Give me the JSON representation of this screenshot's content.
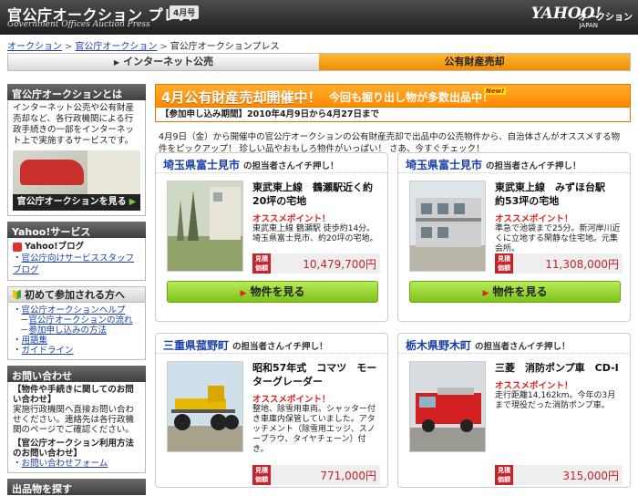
{
  "header": {
    "title": "官公庁オークション プレス",
    "issue_badge": "4月号",
    "subtitle": "Government Offices Auction Press",
    "logo": "YAHOO!",
    "logo_sub": "JAPAN",
    "auction_label": "オークション"
  },
  "breadcrumb": {
    "items": [
      "オークション",
      "官公庁オークション",
      "官公庁オークションプレス"
    ]
  },
  "tabs": [
    {
      "label": "インターネット公売",
      "active": false
    },
    {
      "label": "公有財産売却",
      "active": true
    }
  ],
  "sidebar": {
    "about": {
      "heading": "官公庁オークションとは",
      "text": "インターネット公売や公有財産売却など、各行政機関による行政手続きの一部をインターネット上で実施するサービスです。",
      "button_label": "官公庁オークションを見る"
    },
    "yahoo_services": {
      "heading": "Yahoo!サービス",
      "items": [
        "Yahoo!ブログ",
        "官公庁向けサービススタッフブログ"
      ]
    },
    "first_time": {
      "heading": "初めて参加される方へ",
      "items": [
        {
          "label": "官公庁オークションヘルプ",
          "indent": false
        },
        {
          "label": "官公庁オークションの流れ",
          "indent": true
        },
        {
          "label": "参加申し込みの方法",
          "indent": true
        },
        {
          "label": "用語集",
          "indent": false
        },
        {
          "label": "ガイドライン",
          "indent": false
        }
      ]
    },
    "contact": {
      "heading": "お問い合わせ",
      "q1_title": "【物件や手続きに関してのお問い合わせ】",
      "q1_text": "実施行政機関へ直接お問い合わせください。連絡先は各行政機関のページでご確認ください。",
      "q2_title": "【官公庁オークション利用方法のお問い合わせ】",
      "q2_link": "お問い合わせフォーム"
    },
    "search_heading": "出品物を探す"
  },
  "main": {
    "banner_title": "4月公有財産売却開催中！",
    "banner_sub": "今回も掘り出し物が多数出品中！",
    "banner_new": "New!",
    "period": "【参加申し込み期間】2010年4月9日から4月27日まで",
    "intro": "4月9日（金）から開催中の官公庁オークションの公有財産売却で出品中の公売物件から、自治体さんがオススメする物件をピックアップ！ 珍しい品やおもしろ物件がいっぱい！ さあ、今すぐチェック！",
    "point_label": "オススメポイント！",
    "price_label": "見積価額",
    "view_label": "物件を見る",
    "header_tail": "の担当者さんイチ押し！",
    "cards": [
      {
        "pref": "埼玉県富士見市",
        "title": "東武東上線　鶴瀬駅近く約20坪の宅地",
        "desc": "東武東上線 鶴瀬駅 徒歩約14分。埼玉県富士見市、約20坪の宅地。",
        "price": "10,479,700円"
      },
      {
        "pref": "埼玉県富士見市",
        "title": "東武東上線　みずほ台駅　約53坪の宅地",
        "desc": "準急で池袋まで25分。新河岸川近くに立地する閑静な住宅地。元集会所。",
        "price": "11,308,000円"
      },
      {
        "pref": "三重県菰野町",
        "title": "昭和57年式　コマツ　モーターグレーダー",
        "desc": "整地、除雪用車両。シャッター付き車庫内保管していました。アタッチメント（除雪用エッジ、スノープラウ、タイヤチェーン）付き。",
        "price": "771,000円"
      },
      {
        "pref": "栃木県野木町",
        "title": "三菱　消防ポンプ車　CD-I",
        "desc": "走行距離14,162km。今年の3月まで現役だった消防ポンプ車。",
        "price": "315,000円"
      }
    ]
  }
}
